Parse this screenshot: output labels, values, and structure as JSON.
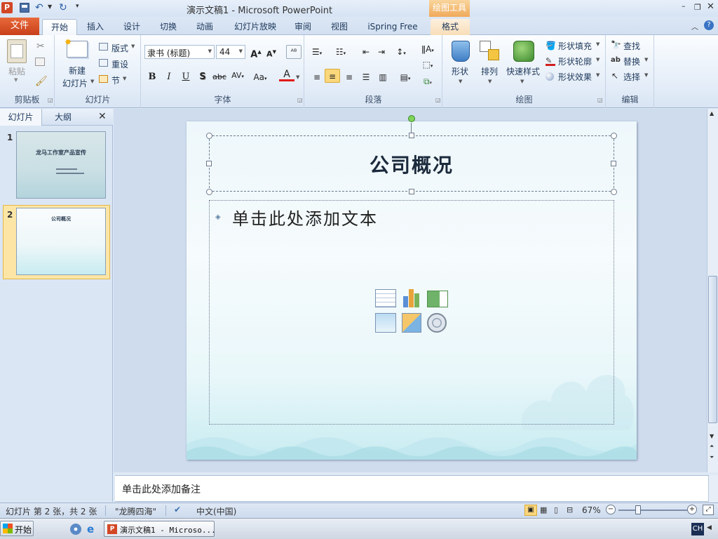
{
  "window": {
    "title": "演示文稿1 - Microsoft PowerPoint",
    "context_tab_group": "绘图工具"
  },
  "tabs": {
    "file": "文件",
    "items": [
      "开始",
      "插入",
      "设计",
      "切换",
      "动画",
      "幻灯片放映",
      "审阅",
      "视图",
      "iSpring Free",
      "格式"
    ]
  },
  "ribbon": {
    "clipboard": {
      "paste": "粘贴",
      "label": "剪贴板"
    },
    "slides": {
      "new_slide_1": "新建",
      "new_slide_2": "幻灯片",
      "layout": "版式",
      "reset": "重设",
      "section": "节",
      "label": "幻灯片"
    },
    "font": {
      "name": "隶书 (标题)",
      "size": "44",
      "label": "字体"
    },
    "paragraph": {
      "label": "段落"
    },
    "drawing": {
      "shapes": "形状",
      "arrange": "排列",
      "quick_styles": "快速样式",
      "fill": "形状填充",
      "outline": "形状轮廓",
      "effects": "形状效果",
      "label": "绘图"
    },
    "editing": {
      "find": "查找",
      "replace": "替换",
      "select": "选择",
      "label": "编辑"
    }
  },
  "left_panel": {
    "tabs": [
      "幻灯片",
      "大纲"
    ],
    "slides": [
      {
        "number": "1",
        "title": "龙马工作室产品宣传"
      },
      {
        "number": "2",
        "title": "公司概况"
      }
    ]
  },
  "slide": {
    "title": "公司概况",
    "body_placeholder": "单击此处添加文本"
  },
  "notes": {
    "placeholder": "单击此处添加备注"
  },
  "status_bar": {
    "slide_info": "幻灯片 第 2 张，共 2 张",
    "theme": "\"龙腾四海\"",
    "language": "中文(中国)",
    "zoom": "67%"
  },
  "taskbar": {
    "start": "开始",
    "active_window": "演示文稿1 - Microso...",
    "ime": "CH"
  },
  "colors": {
    "file_tab": "#d9501f",
    "context_tab": "#f5b774",
    "accent_blue": "#1e395b"
  }
}
